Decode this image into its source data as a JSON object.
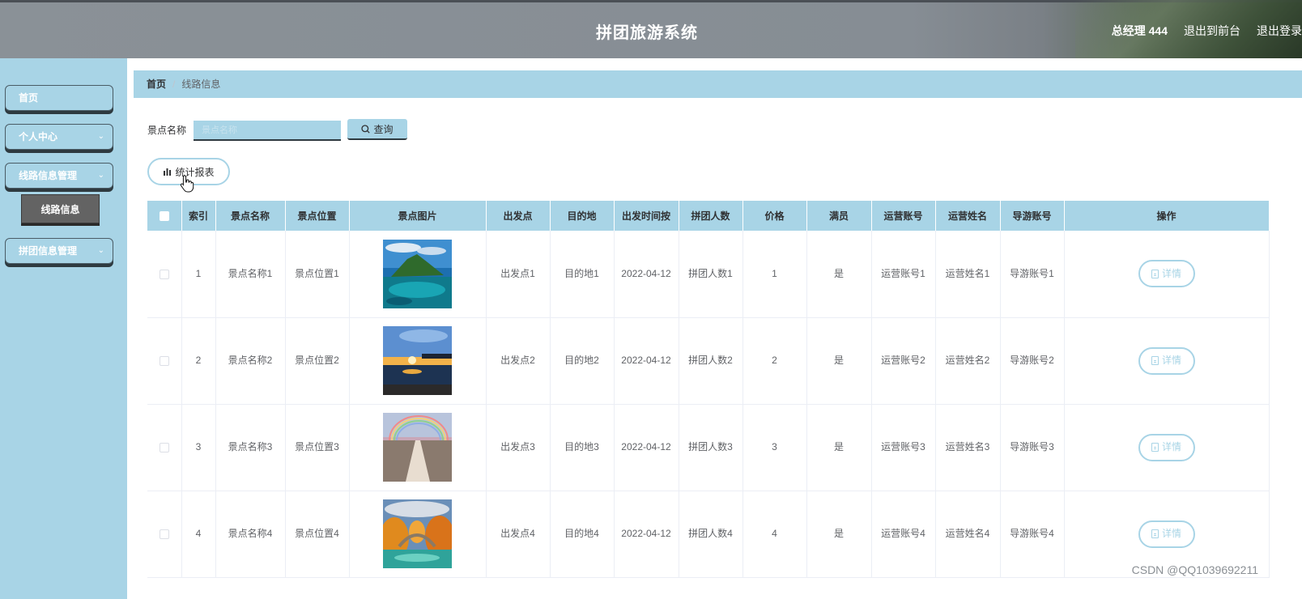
{
  "header": {
    "title": "拼团旅游系统",
    "user": "总经理 444",
    "frontend_link": "退出到前台",
    "logout_link": "退出登录"
  },
  "sidebar": {
    "items": [
      {
        "label": "首页"
      },
      {
        "label": "个人中心"
      },
      {
        "label": "线路信息管理"
      },
      {
        "label": "拼团信息管理"
      }
    ],
    "active_sub": "线路信息"
  },
  "breadcrumb": {
    "home": "首页",
    "current": "线路信息"
  },
  "search": {
    "label": "景点名称",
    "placeholder": "景点名称",
    "button": "查询"
  },
  "report_button": "统计报表",
  "table": {
    "headers": [
      "索引",
      "景点名称",
      "景点位置",
      "景点图片",
      "出发点",
      "目的地",
      "出发时间按",
      "拼团人数",
      "价格",
      "满员",
      "运营账号",
      "运营姓名",
      "导游账号",
      "操作"
    ],
    "rows": [
      {
        "idx": "1",
        "name": "景点名称1",
        "loc": "景点位置1",
        "from": "出发点1",
        "to": "目的地1",
        "time": "2022-04-12",
        "people": "拼团人数1",
        "price": "1",
        "full": "是",
        "op_acc": "运营账号1",
        "op_name": "运营姓名1",
        "guide": "导游账号1",
        "action": "详情"
      },
      {
        "idx": "2",
        "name": "景点名称2",
        "loc": "景点位置2",
        "from": "出发点2",
        "to": "目的地2",
        "time": "2022-04-12",
        "people": "拼团人数2",
        "price": "2",
        "full": "是",
        "op_acc": "运营账号2",
        "op_name": "运营姓名2",
        "guide": "导游账号2",
        "action": "详情"
      },
      {
        "idx": "3",
        "name": "景点名称3",
        "loc": "景点位置3",
        "from": "出发点3",
        "to": "目的地3",
        "time": "2022-04-12",
        "people": "拼团人数3",
        "price": "3",
        "full": "是",
        "op_acc": "运营账号3",
        "op_name": "运营姓名3",
        "guide": "导游账号3",
        "action": "详情"
      },
      {
        "idx": "4",
        "name": "景点名称4",
        "loc": "景点位置4",
        "from": "出发点4",
        "to": "目的地4",
        "time": "2022-04-12",
        "people": "拼团人数4",
        "price": "4",
        "full": "是",
        "op_acc": "运营账号4",
        "op_name": "运营姓名4",
        "guide": "导游账号4",
        "action": "详情"
      }
    ]
  },
  "watermark": "CSDN @QQ1039692211",
  "colors": {
    "accent": "#a8d4e6",
    "header": "#868d94",
    "active_sub": "#636363"
  }
}
